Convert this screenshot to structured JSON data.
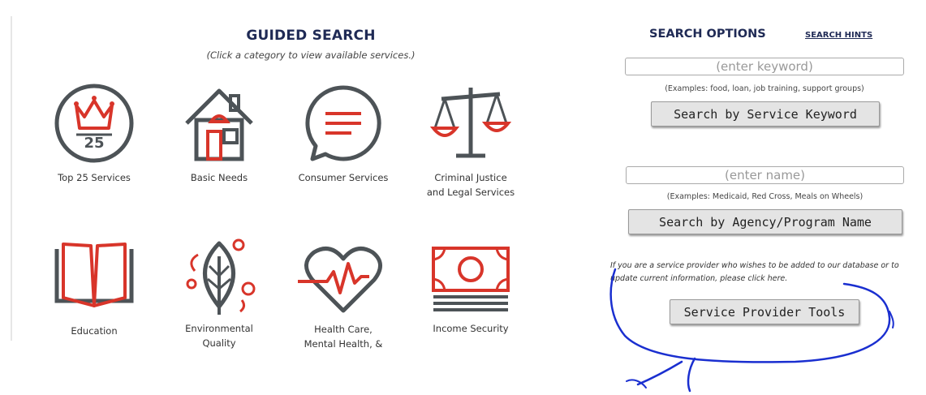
{
  "guided_search": {
    "title": "GUIDED SEARCH",
    "subtitle": "(Click a category to view available services.)",
    "categories": [
      {
        "label": "Top 25 Services",
        "icon": "crown-25-icon"
      },
      {
        "label": "Basic Needs",
        "icon": "house-icon"
      },
      {
        "label": "Consumer Services",
        "icon": "speech-bubble-icon"
      },
      {
        "label": "Criminal Justice and Legal Services",
        "icon": "scales-of-justice-icon"
      },
      {
        "label": "Education",
        "icon": "open-book-icon"
      },
      {
        "label": "Environmental Quality",
        "icon": "leaf-icon"
      },
      {
        "label": "Health Care, Mental Health, &",
        "icon": "heart-pulse-icon"
      },
      {
        "label": "Income Security",
        "icon": "money-icon"
      }
    ]
  },
  "search_options": {
    "title": "SEARCH OPTIONS",
    "hints_link": "SEARCH HINTS",
    "keyword": {
      "placeholder": "(enter keyword)",
      "examples": "(Examples: food, loan, job training, support groups)",
      "button": "Search by Service Keyword"
    },
    "name": {
      "placeholder": "(enter name)",
      "examples": "(Examples: Medicaid, Red Cross, Meals on Wheels)",
      "button": "Search by Agency/Program Name"
    },
    "provider_note": "If you are a service provider who wishes to be added to our database or to update current information, please click here.",
    "provider_button": "Service Provider Tools"
  },
  "colors": {
    "heading_navy": "#1f2a55",
    "icon_gray": "#4d5357",
    "icon_red": "#d8352a",
    "annotation_blue": "#1a2fd0"
  }
}
